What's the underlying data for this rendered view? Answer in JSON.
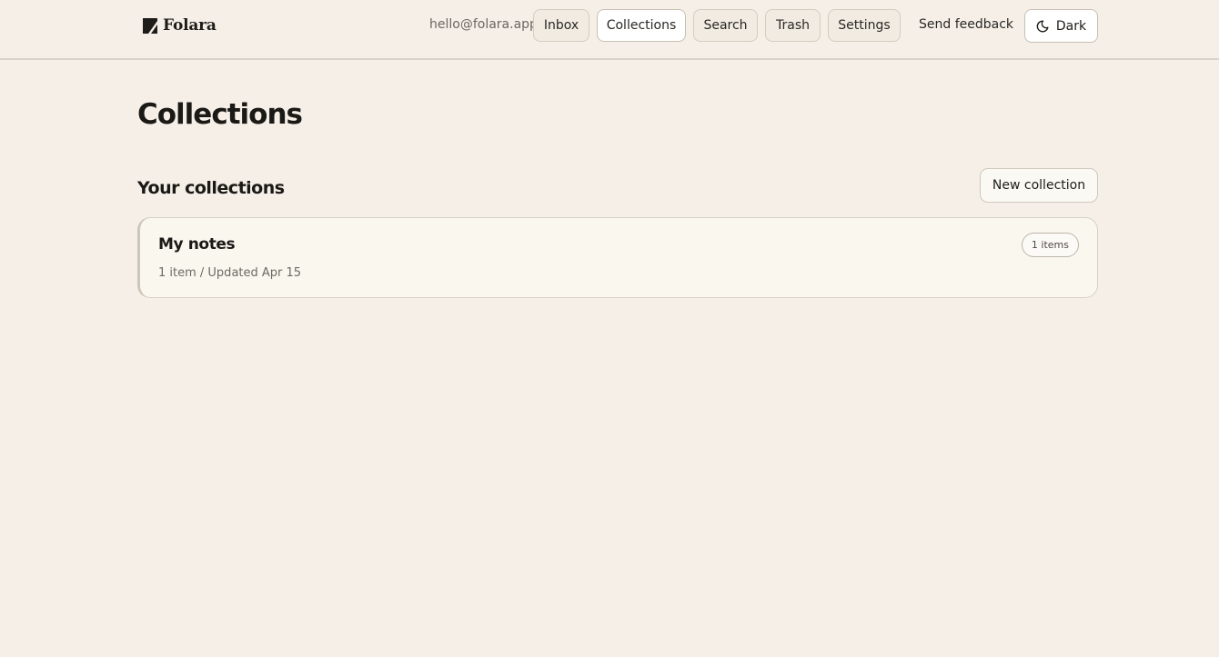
{
  "app": {
    "name": "Folara",
    "user_email": "hello@folara.app"
  },
  "nav": {
    "inbox": "Inbox",
    "collections": "Collections",
    "search": "Search",
    "trash": "Trash",
    "settings": "Settings",
    "feedback": "Send feedback",
    "theme_toggle": "Dark",
    "active": "Collections"
  },
  "page": {
    "title": "Collections",
    "section_title": "Your collections",
    "new_button": "New collection"
  },
  "collections": [
    {
      "name": "My notes",
      "meta": "1 item / Updated Apr 15",
      "badge": "1 items"
    }
  ],
  "icons": {
    "logo": "folara-logo-icon",
    "theme": "moon-icon"
  },
  "colors": {
    "background": "#f5efe7",
    "card": "#faf7ef",
    "text": "#1f1d1a",
    "muted": "#6e6a63"
  }
}
